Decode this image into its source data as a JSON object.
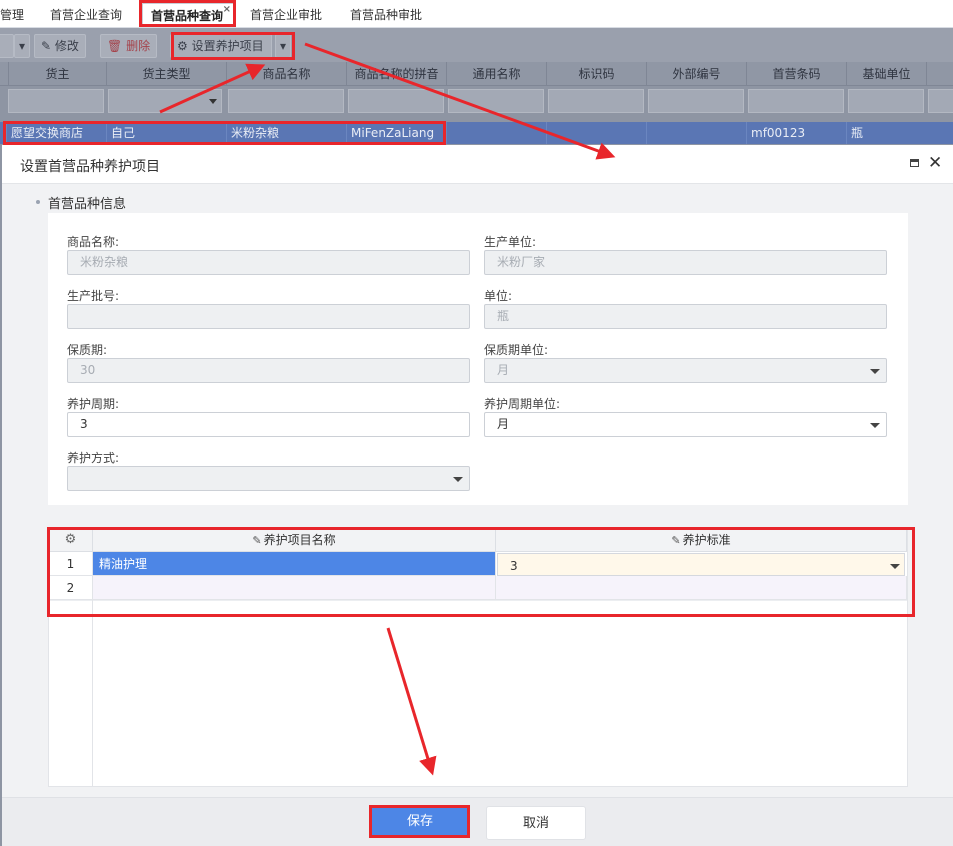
{
  "tabs": [
    {
      "label": "管理"
    },
    {
      "label": "首营企业查询"
    },
    {
      "label": "首营品种查询",
      "close": "×"
    },
    {
      "label": "首营企业审批"
    },
    {
      "label": "首营品种审批"
    }
  ],
  "toolbar": {
    "edit_label": "修改",
    "delete_label": "删除",
    "care_label": "设置养护项目"
  },
  "grid_columns": [
    "货主",
    "货主类型",
    "商品名称",
    "商品名称的拼音",
    "通用名称",
    "标识码",
    "外部编号",
    "首营条码",
    "基础单位"
  ],
  "grid_row": {
    "owner": "愿望交换商店",
    "owner_type": "自己",
    "product_name": "米粉杂粮",
    "pinyin": "MiFenZaLiang",
    "barcode": "mf00123",
    "base_unit": "瓶"
  },
  "dialog": {
    "title": "设置首营品种养护项目",
    "section_title": "首营品种信息",
    "fields": {
      "product_name": {
        "label": "商品名称:",
        "value": "米粉杂粮"
      },
      "producer": {
        "label": "生产单位:",
        "value": "米粉厂家"
      },
      "batch_no": {
        "label": "生产批号:",
        "value": ""
      },
      "unit": {
        "label": "单位:",
        "value": "瓶"
      },
      "shelf_life": {
        "label": "保质期:",
        "value": "30"
      },
      "shelf_life_unit": {
        "label": "保质期单位:",
        "value": "月"
      },
      "care_cycle": {
        "label": "养护周期:",
        "value": "3"
      },
      "care_cycle_unit": {
        "label": "养护周期单位:",
        "value": "月"
      },
      "care_method": {
        "label": "养护方式:",
        "value": ""
      }
    },
    "care_grid": {
      "columns": [
        "养护项目名称",
        "养护标准"
      ],
      "rows": [
        {
          "num": "1",
          "name": "精油护理",
          "standard": "3"
        },
        {
          "num": "2",
          "name": "",
          "standard": ""
        }
      ]
    },
    "save_label": "保存",
    "cancel_label": "取消"
  },
  "colors": {
    "accent": "#4d86e6",
    "annotation": "#e8262b"
  }
}
